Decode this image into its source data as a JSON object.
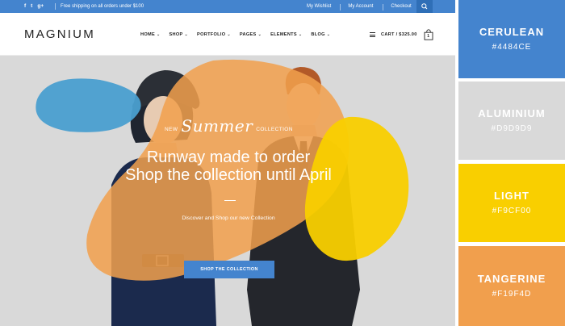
{
  "topbar": {
    "social": [
      "f",
      "t",
      "g+"
    ],
    "shipping": "Free shipping on all orders under $100",
    "links": [
      "My Wishlist",
      "My Account",
      "Checkout"
    ]
  },
  "header": {
    "logo": "MAGNIUM",
    "nav": [
      "HOME",
      "SHOP",
      "PORTFOLIO",
      "PAGES",
      "ELEMENTS",
      "BLOG"
    ],
    "cart_label": "CART / $325.00",
    "cart_count": "1"
  },
  "hero": {
    "kicker_new": "NEW",
    "kicker_script": "Summer",
    "kicker_collection": "COLLECTION",
    "headline_1": "Runway made to order",
    "headline_2": "Shop the collection until April",
    "subline": "Discover and Shop our new Collection",
    "cta": "SHOP THE COLLECTION"
  },
  "palette": [
    {
      "name": "CERULEAN",
      "hex": "#4484CE"
    },
    {
      "name": "ALUMINIUM",
      "hex": "#D9D9D9"
    },
    {
      "name": "LIGHT",
      "hex": "#F9CF00"
    },
    {
      "name": "TANGERINE",
      "hex": "#F19F4D"
    }
  ],
  "colors": {
    "cerulean": "#4484CE",
    "aluminium": "#D9D9D9",
    "light": "#F9CF00",
    "tangerine": "#F19F4D"
  }
}
